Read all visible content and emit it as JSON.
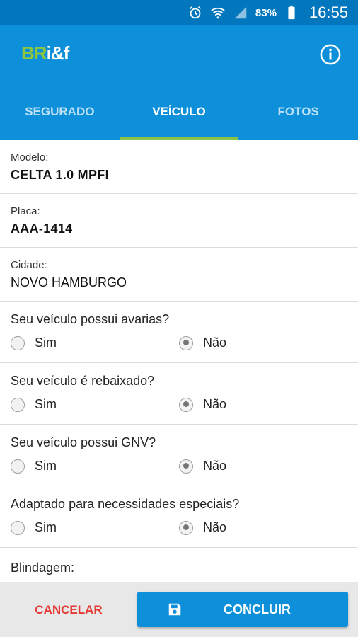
{
  "status_bar": {
    "battery_percent": "83%",
    "time": "16:55",
    "icons": [
      "alarm-icon",
      "wifi-icon",
      "signal-icon",
      "battery-icon"
    ]
  },
  "app_bar": {
    "logo_br": "BR",
    "logo_rest": "i&f",
    "info_icon": "info-icon"
  },
  "tabs": [
    {
      "label": "SEGURADO",
      "active": false
    },
    {
      "label": "VEÍCULO",
      "active": true
    },
    {
      "label": "FOTOS",
      "active": false
    }
  ],
  "fields": {
    "modelo": {
      "label": "Modelo:",
      "value": "CELTA 1.0 MPFI"
    },
    "placa": {
      "label": "Placa:",
      "value": "AAA-1414"
    },
    "cidade": {
      "label": "Cidade:",
      "value": "NOVO HAMBURGO"
    }
  },
  "questions": [
    {
      "question": "Seu veículo possui avarias?",
      "yes": "Sim",
      "no": "Não",
      "selected": "Não"
    },
    {
      "question": "Seu veículo é rebaixado?",
      "yes": "Sim",
      "no": "Não",
      "selected": "Não"
    },
    {
      "question": "Seu veículo possui GNV?",
      "yes": "Sim",
      "no": "Não",
      "selected": "Não"
    },
    {
      "question": "Adaptado para necessidades especiais?",
      "yes": "Sim",
      "no": "Não",
      "selected": "Não"
    }
  ],
  "blindagem_label": "Blindagem:",
  "actions": {
    "cancel": "CANCELAR",
    "conclude": "CONCLUIR",
    "conclude_icon": "save-icon"
  },
  "colors": {
    "primary": "#0D8FDA",
    "status_bar": "#0277BD",
    "tab_indicator": "#8BC34A",
    "cancel_text": "#E53935",
    "logo_green": "#8DC63F"
  }
}
